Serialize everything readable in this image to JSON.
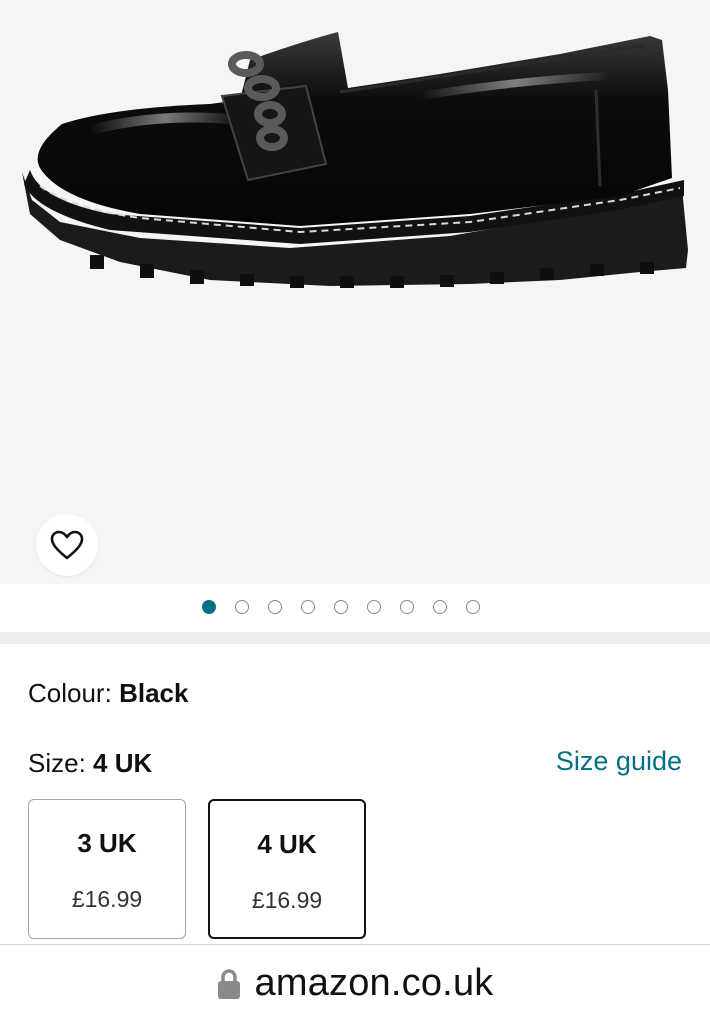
{
  "product": {
    "image_alt_icon": "loafer-shoe-photo",
    "wishlist_icon": "heart-icon",
    "carousel": {
      "total": 9,
      "active_index": 0
    }
  },
  "colour": {
    "label": "Colour:",
    "value": "Black"
  },
  "size": {
    "label": "Size:",
    "value": "4 UK",
    "guide_label": "Size guide",
    "options": [
      {
        "size": "3 UK",
        "price": "£16.99",
        "selected": false
      },
      {
        "size": "4 UK",
        "price": "£16.99",
        "selected": true
      }
    ]
  },
  "browser": {
    "lock_icon": "lock-icon",
    "domain": "amazon.co.uk"
  },
  "colors": {
    "accent": "#007185",
    "text": "#0f1111"
  }
}
